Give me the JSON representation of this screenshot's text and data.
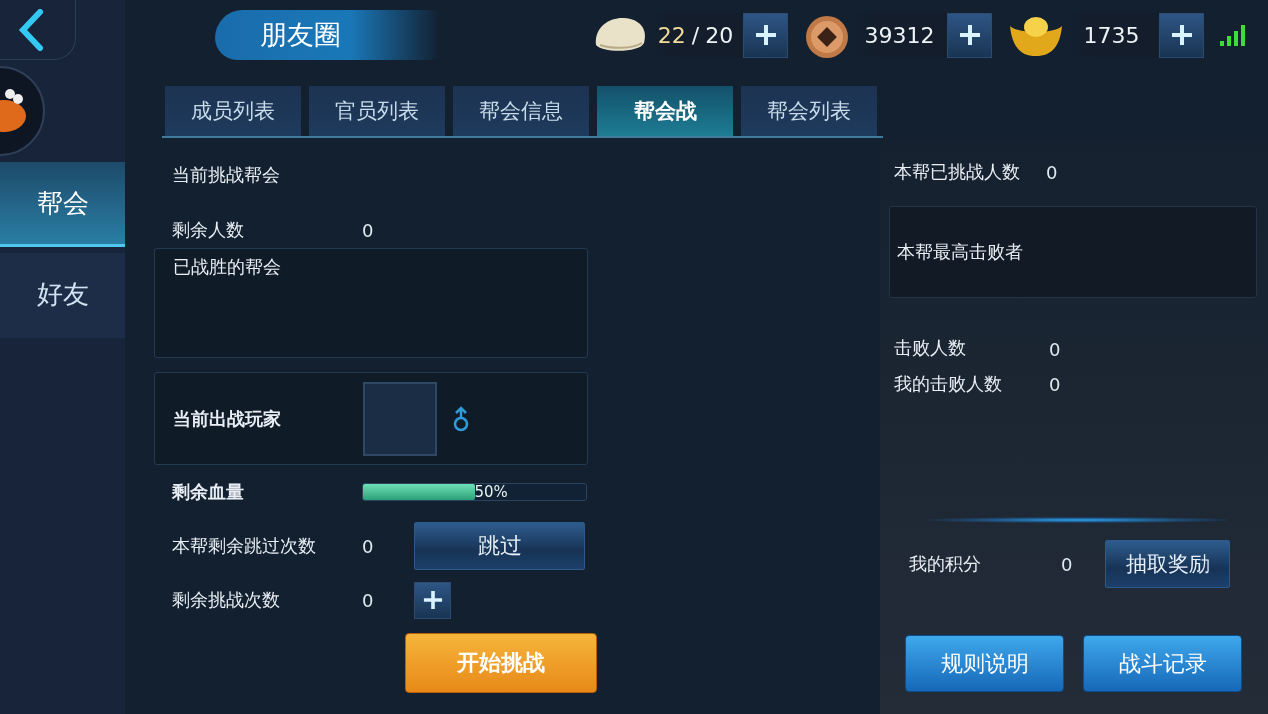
{
  "title": "朋友圈",
  "resources": [
    {
      "kind": "bun",
      "current": "22",
      "separator": "/",
      "max": "20"
    },
    {
      "kind": "coin",
      "amount": "39312"
    },
    {
      "kind": "ingot",
      "amount": "1735"
    }
  ],
  "side_tabs": [
    {
      "label": "帮会",
      "selected": true
    },
    {
      "label": "好友",
      "selected": false
    }
  ],
  "tabs": [
    {
      "label": "成员列表",
      "selected": false
    },
    {
      "label": "官员列表",
      "selected": false
    },
    {
      "label": "帮会信息",
      "selected": false
    },
    {
      "label": "帮会战",
      "selected": true
    },
    {
      "label": "帮会列表",
      "selected": false
    }
  ],
  "left": {
    "current_guild_label": "当前挑战帮会",
    "remaining_members": {
      "label": "剩余人数",
      "value": "0"
    },
    "defeated_guilds": {
      "title": "已战胜的帮会"
    },
    "current_player": {
      "label": "当前出战玩家"
    },
    "hp": {
      "label": "剩余血量",
      "level": 0.5,
      "reading": "50%"
    },
    "skips": {
      "label": "本帮剩余跳过次数",
      "value": "0",
      "button": "跳过"
    },
    "challenges": {
      "label": "剩余挑战次数",
      "value": "0"
    },
    "start_button": "开始挑战"
  },
  "right": {
    "challenged": {
      "label": "本帮已挑战人数",
      "value": "0"
    },
    "top_defeater": {
      "title": "本帮最高击败者"
    },
    "defeats": {
      "label": "击败人数",
      "value": "0"
    },
    "my_defeats": {
      "label": "我的击败人数",
      "value": "0"
    },
    "points": {
      "label": "我的积分",
      "value": "0",
      "button": "抽取奖励"
    },
    "buttons": [
      "规则说明",
      "战斗记录"
    ]
  }
}
